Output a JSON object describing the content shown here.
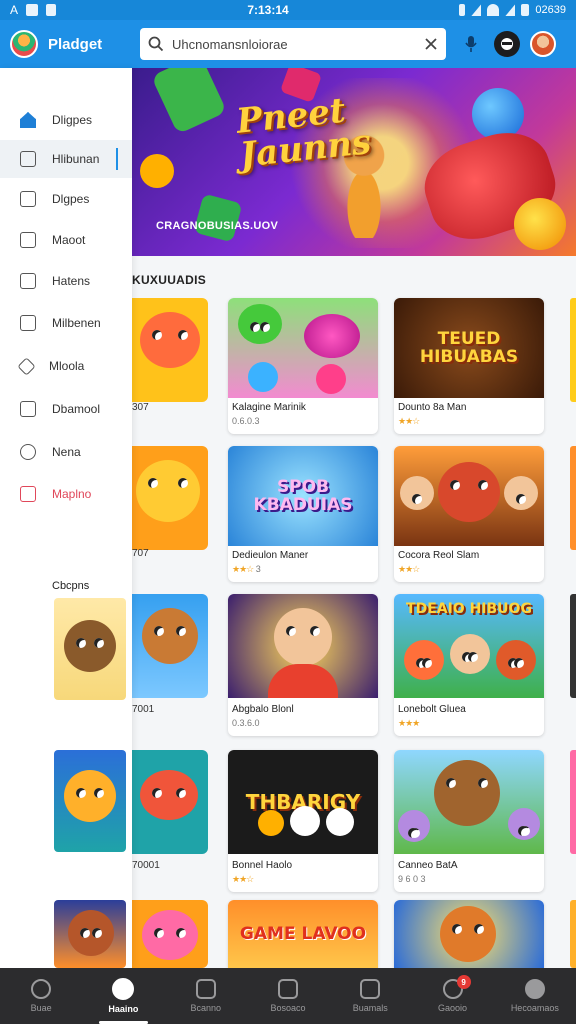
{
  "status_bar": {
    "left": "A",
    "time": "7:13:14",
    "battery": "02639"
  },
  "header": {
    "app_title": "Pladget",
    "search_value": "Uhcnomansnloiorae",
    "search_placeholder": "Search"
  },
  "sidebar": {
    "items": [
      {
        "label": "Dligpes",
        "icon": "home-icon"
      },
      {
        "label": "Hlibunan",
        "icon": "clock-icon"
      },
      {
        "label": "Dlgpes",
        "icon": "checkbox-icon"
      },
      {
        "label": "Maoot",
        "icon": "monitor-icon"
      },
      {
        "label": "Hatens",
        "icon": "grid-icon"
      },
      {
        "label": "Milbenen",
        "icon": "square-icon"
      },
      {
        "label": "Mloola",
        "icon": "diamond-icon"
      },
      {
        "label": "Dbamool",
        "icon": "document-icon"
      },
      {
        "label": "Nena",
        "icon": "circle-icon"
      },
      {
        "label": "Maplno",
        "icon": "heart-icon"
      }
    ],
    "section_title": "Cbcpns"
  },
  "hero": {
    "title": "Pneet Jaunns",
    "caption": "CRAGNOBUSIAS.UOV"
  },
  "section": {
    "title": "KUXUUADIS"
  },
  "col0_labels": [
    "307",
    "707",
    "7001",
    "70001"
  ],
  "cards": [
    {
      "name": "Kalagine Marinik",
      "rating": "0.6.0.3",
      "stars": "",
      "art": "Candy Match",
      "art_text": ""
    },
    {
      "name": "Dounto 8a Man",
      "rating": "",
      "stars": "★★☆",
      "art": "Poster",
      "art_text": "TEUED HIBUABAS"
    },
    {
      "name": "Dedieulon Maner",
      "rating": "3",
      "stars": "★★☆",
      "art": "Logo",
      "art_text": "SPOB KBADUIAS"
    },
    {
      "name": "Cocora Reol Slam",
      "rating": "",
      "stars": "★★☆",
      "art": "Friends",
      "art_text": ""
    },
    {
      "name": "Abgbalo Blonl",
      "rating": "0.3.6.0",
      "stars": "",
      "art": "Boy",
      "art_text": ""
    },
    {
      "name": "Lonebolt Gluea",
      "rating": "",
      "stars": "★★★",
      "art": "Adventure",
      "art_text": "TDEAIO HIBUOG"
    },
    {
      "name": "Bonnel Haolo",
      "rating": "",
      "stars": "★★☆",
      "art": "Orbs",
      "art_text": "THBARIGY"
    },
    {
      "name": "Canneo BatA",
      "rating": "9 6 0 3",
      "stars": "",
      "art": "Kangaroo",
      "art_text": ""
    },
    {
      "name": "",
      "rating": "",
      "stars": "",
      "art": "Game",
      "art_text": "GAME LAVOO"
    },
    {
      "name": "",
      "rating": "",
      "stars": "",
      "art": "Fox",
      "art_text": ""
    }
  ],
  "bottom_nav": [
    {
      "label": "Buae",
      "icon": "home-icon"
    },
    {
      "label": "Haaino",
      "icon": "drop-icon"
    },
    {
      "label": "Bcanno",
      "icon": "box-icon"
    },
    {
      "label": "Bosoaco",
      "icon": "grid-icon"
    },
    {
      "label": "Buamals",
      "icon": "chart-icon"
    },
    {
      "label": "Gaooio",
      "icon": "gamepad-icon",
      "badge": "9"
    },
    {
      "label": "Hecoamaos",
      "icon": "person-icon"
    }
  ],
  "colors": {
    "status_bar": "#1787d8",
    "header": "#1e90e6",
    "accent": "#1e90e6",
    "nav_bg": "#2c2c2e",
    "alert": "#e0475a"
  }
}
